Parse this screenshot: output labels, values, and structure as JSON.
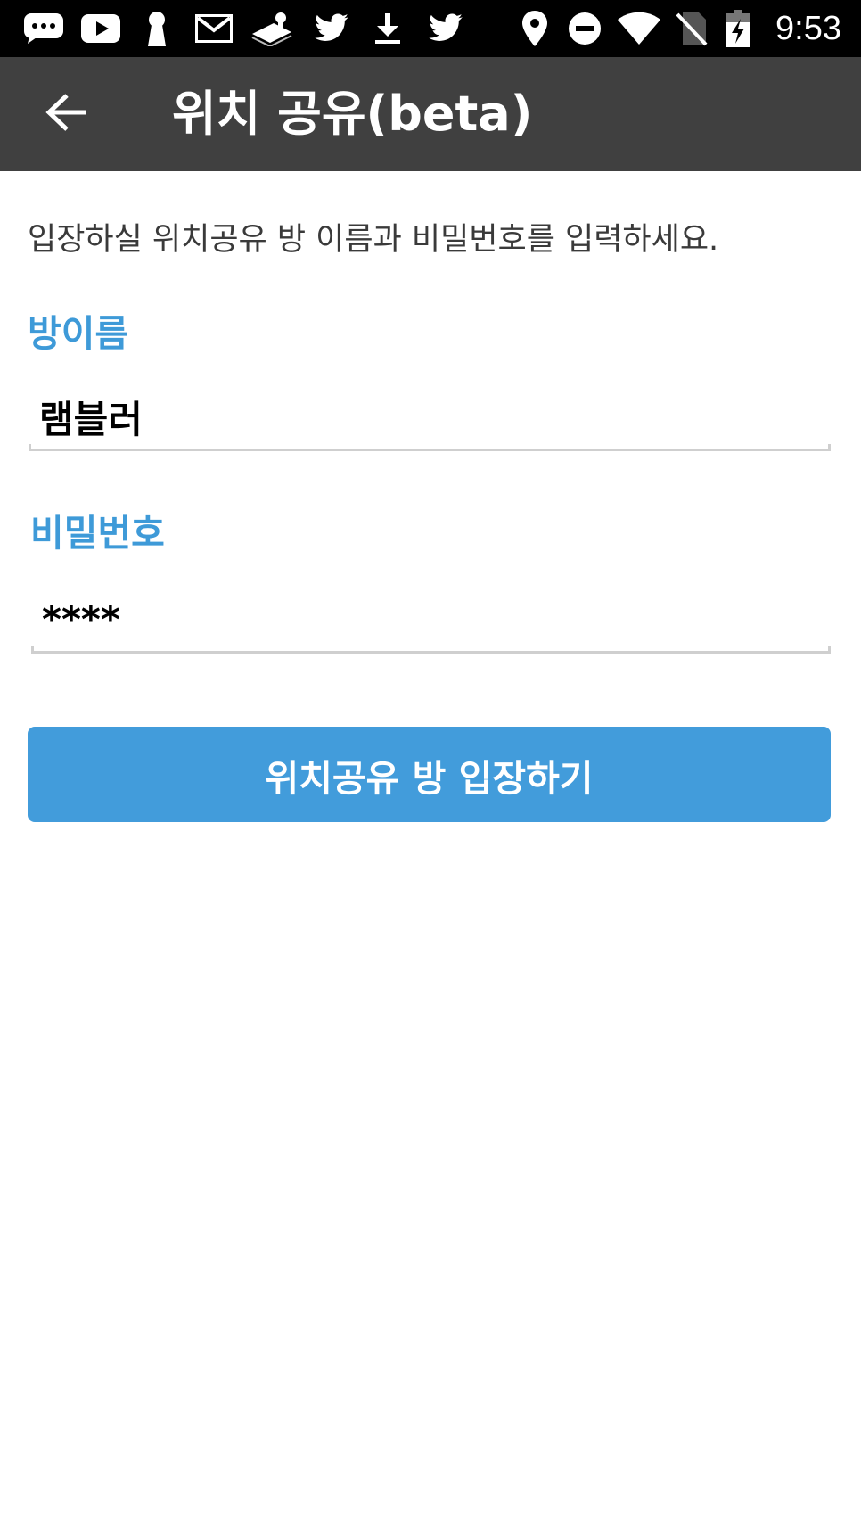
{
  "status_bar": {
    "time": "9:53",
    "icons": [
      "chat-bubble-icon",
      "youtube-icon",
      "keyhole-icon",
      "gmail-icon",
      "paper-stack-icon",
      "twitter-icon",
      "download-icon",
      "twitter-icon",
      "location-pin-icon",
      "do-not-disturb-icon",
      "wifi-icon",
      "no-sim-icon",
      "battery-charging-icon"
    ]
  },
  "app_bar": {
    "title": "위치 공유(beta)",
    "back_icon": "arrow-back-icon"
  },
  "form": {
    "instruction": "입장하실 위치공유 방 이름과 비밀번호를 입력하세요.",
    "room_label": "방이름",
    "room_value": "램블러",
    "password_label": "비밀번호",
    "password_value": "****",
    "submit_label": "위치공유 방 입장하기"
  },
  "colors": {
    "status_bar_bg": "#000000",
    "app_bar_bg": "#404040",
    "accent": "#3e9ad8",
    "button_bg": "#429cdb"
  }
}
